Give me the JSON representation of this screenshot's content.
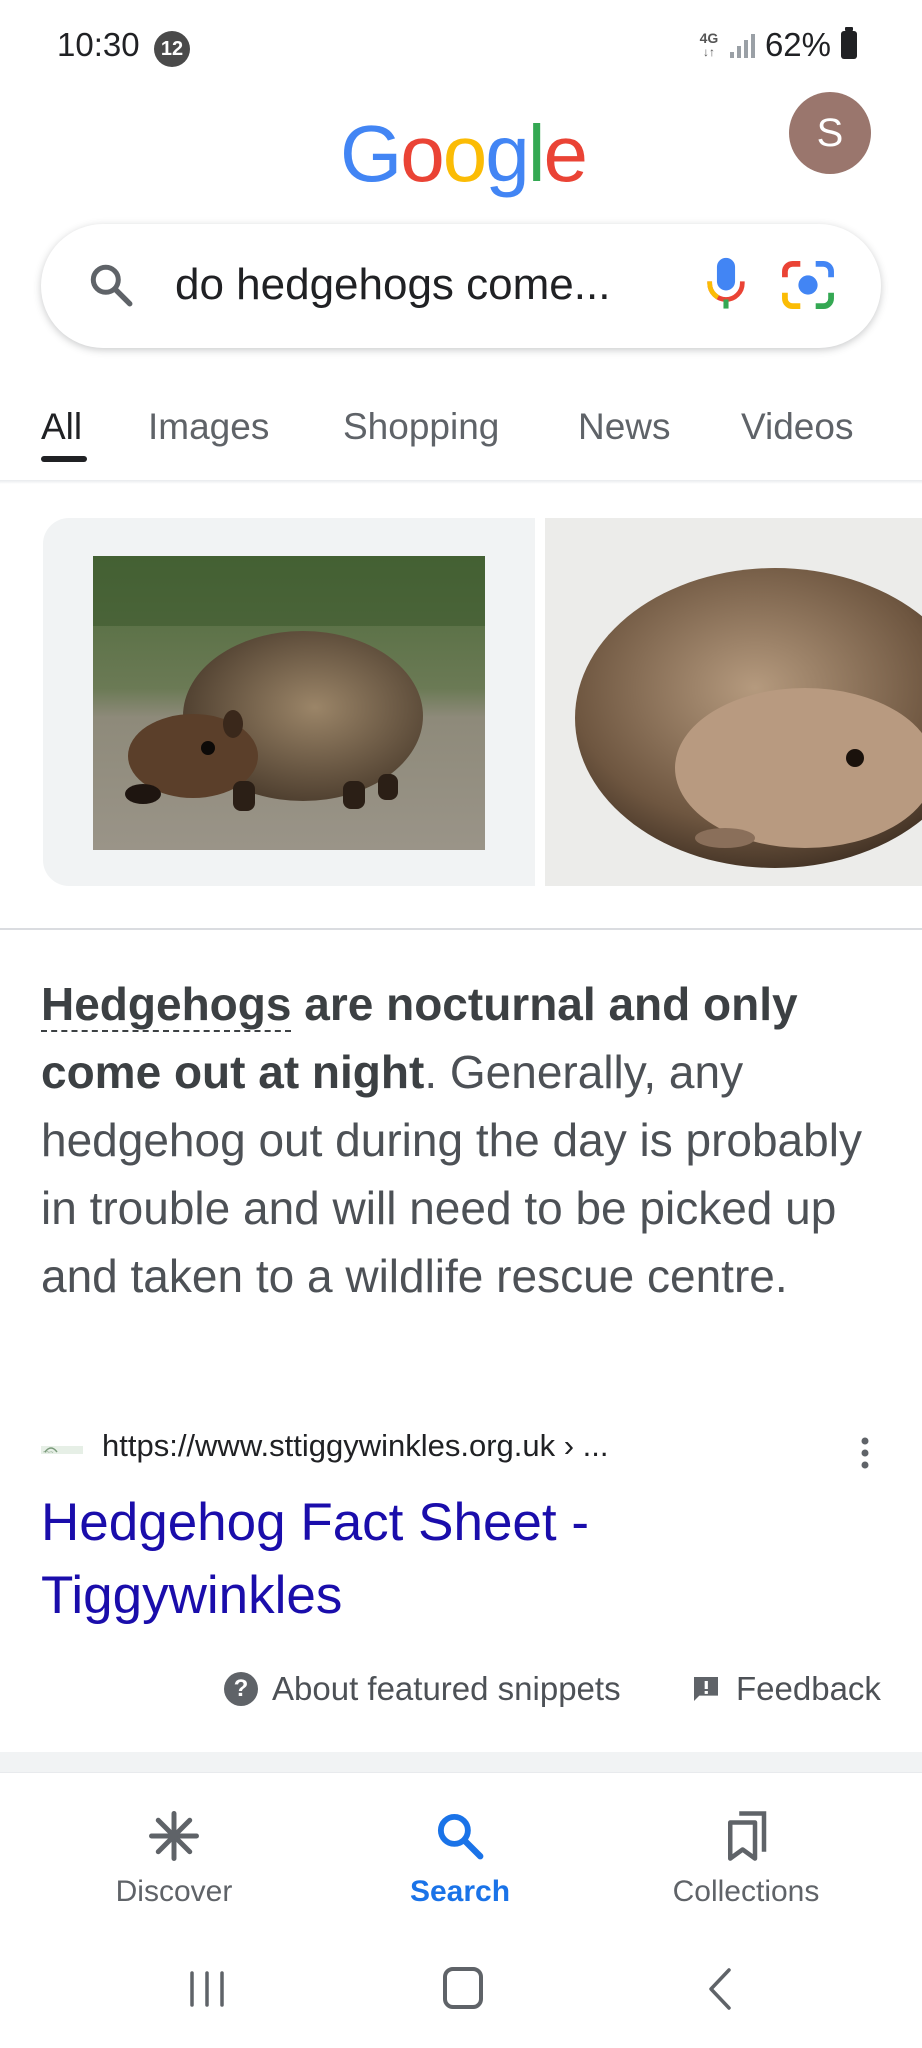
{
  "status_bar": {
    "time": "10:30",
    "notification_count": "12",
    "network_type": "4G",
    "battery": "62%"
  },
  "header": {
    "logo_letters": [
      {
        "char": "G",
        "color": "#4285F4"
      },
      {
        "char": "o",
        "color": "#EA4335"
      },
      {
        "char": "o",
        "color": "#FBBC05"
      },
      {
        "char": "g",
        "color": "#4285F4"
      },
      {
        "char": "l",
        "color": "#34A853"
      },
      {
        "char": "e",
        "color": "#EA4335"
      }
    ],
    "avatar_initial": "S"
  },
  "search": {
    "query": "do hedgehogs come..."
  },
  "tabs": [
    "All",
    "Images",
    "Shopping",
    "News",
    "Videos"
  ],
  "snippet": {
    "bold_term": "Hedgehogs",
    "bold_rest": " are nocturnal and only come out at night",
    "body": ". Generally, any hedgehog out during the day is probably in trouble and will need to be picked up and taken to a wildlife rescue centre."
  },
  "source": {
    "url": "https://www.sttiggywinkles.org.uk › ...",
    "title": "Hedgehog Fact Sheet - Tiggywinkles"
  },
  "footer_links": {
    "about": "About featured snippets",
    "feedback": "Feedback"
  },
  "bottom_nav": {
    "discover": "Discover",
    "search": "Search",
    "collections": "Collections"
  },
  "colors": {
    "link_blue": "#1a0dab",
    "accent_blue": "#1a73e8",
    "avatar_bg": "#9a766d"
  }
}
